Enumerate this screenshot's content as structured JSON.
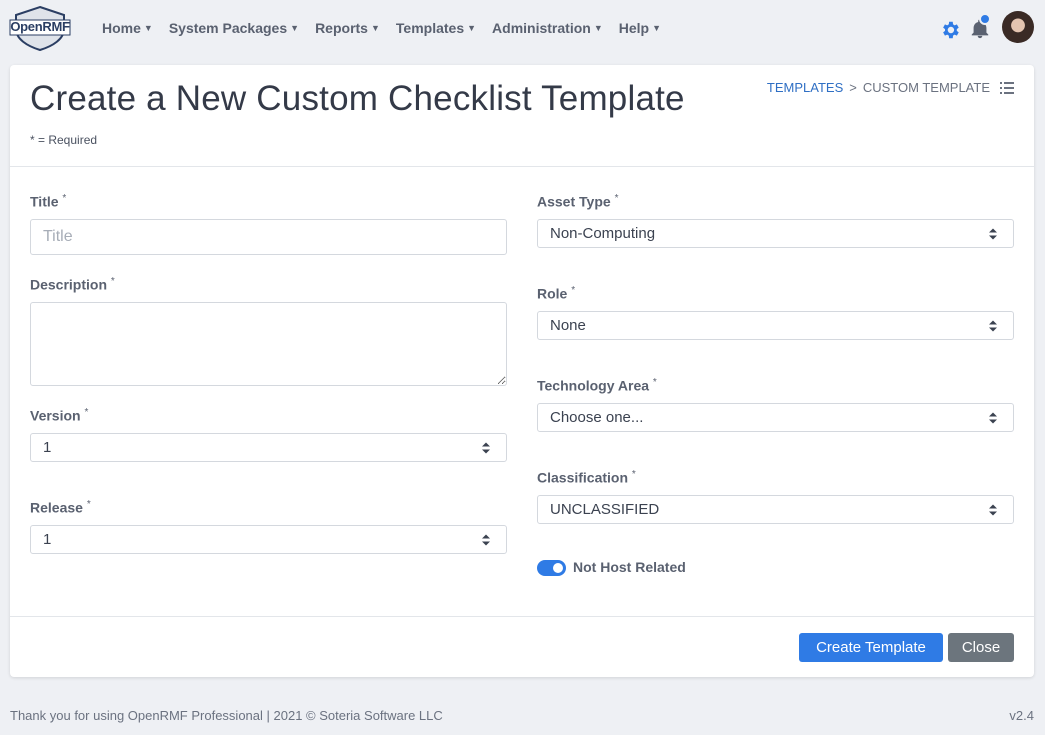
{
  "app": {
    "logo_text": "OpenRMF",
    "accent_color": "#2f7be5"
  },
  "nav": {
    "items": [
      {
        "label": "Home"
      },
      {
        "label": "System Packages"
      },
      {
        "label": "Reports"
      },
      {
        "label": "Templates"
      },
      {
        "label": "Administration"
      },
      {
        "label": "Help"
      }
    ]
  },
  "header": {
    "icons": [
      "gear-icon",
      "bell-icon",
      "avatar"
    ]
  },
  "page": {
    "title": "Create a New Custom Checklist Template",
    "required_note": "* = Required",
    "breadcrumb": {
      "link": "TEMPLATES",
      "separator": ">",
      "current": "CUSTOM TEMPLATE"
    }
  },
  "form": {
    "title": {
      "label": "Title",
      "required": "*",
      "placeholder": "Title",
      "value": ""
    },
    "description": {
      "label": "Description",
      "required": "*",
      "value": ""
    },
    "version": {
      "label": "Version",
      "required": "*",
      "value": "1"
    },
    "release": {
      "label": "Release",
      "required": "*",
      "value": "1"
    },
    "asset_type": {
      "label": "Asset Type",
      "required": "*",
      "value": "Non-Computing"
    },
    "role": {
      "label": "Role",
      "required": "*",
      "value": "None"
    },
    "technology_area": {
      "label": "Technology Area",
      "required": "*",
      "value": "Choose one..."
    },
    "classification": {
      "label": "Classification",
      "required": "*",
      "value": "UNCLASSIFIED"
    },
    "not_host_related": {
      "label": "Not Host Related",
      "checked": true
    }
  },
  "actions": {
    "create_label": "Create Template",
    "close_label": "Close"
  },
  "footer": {
    "text": "Thank you for using OpenRMF Professional | 2021 © Soteria Software LLC",
    "version": "v2.4"
  }
}
